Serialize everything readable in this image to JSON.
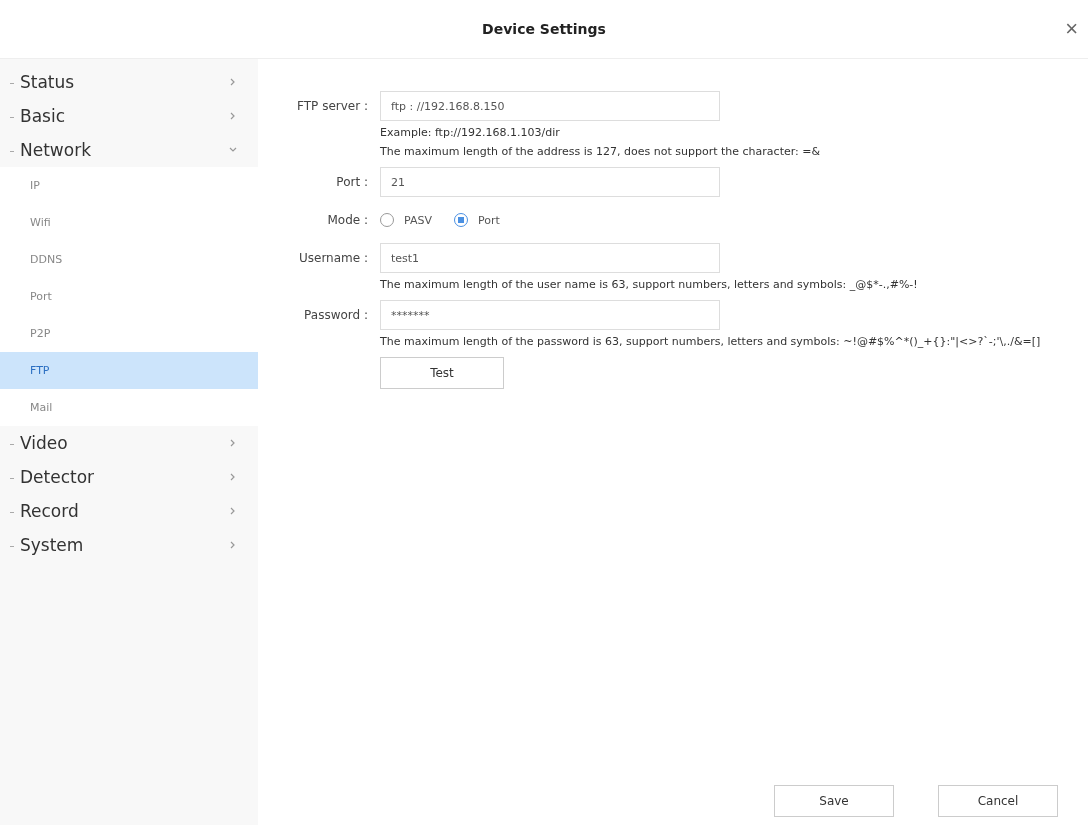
{
  "window": {
    "title": "Device Settings",
    "close": "×"
  },
  "sidebar": {
    "items": [
      {
        "label": "Status",
        "expanded": false,
        "selected": false
      },
      {
        "label": "Basic",
        "expanded": false,
        "selected": false
      },
      {
        "label": "Network",
        "expanded": true,
        "selected": false,
        "children": [
          {
            "label": "IP",
            "selected": false
          },
          {
            "label": "Wifi",
            "selected": false
          },
          {
            "label": "DDNS",
            "selected": false
          },
          {
            "label": "Port",
            "selected": false
          },
          {
            "label": "P2P",
            "selected": false
          },
          {
            "label": "FTP",
            "selected": true
          },
          {
            "label": "Mail",
            "selected": false
          }
        ]
      },
      {
        "label": "Video",
        "expanded": false,
        "selected": false
      },
      {
        "label": "Detector",
        "expanded": false,
        "selected": false
      },
      {
        "label": "Record",
        "expanded": false,
        "selected": false
      },
      {
        "label": "System",
        "expanded": false,
        "selected": false
      }
    ]
  },
  "form": {
    "rows": [
      {
        "kind": "text",
        "label": "FTP server :",
        "value": "ftp : //192.168.8.150",
        "hints": [
          "Example: ftp://192.168.1.103/dir",
          "The maximum length of the address is 127, does not support the character: =&"
        ]
      },
      {
        "kind": "text",
        "label": "Port :",
        "value": "21"
      },
      {
        "kind": "radio",
        "label": "Mode :",
        "options": [
          {
            "label": "PASV",
            "selected": false
          },
          {
            "label": "Port",
            "selected": true
          }
        ]
      },
      {
        "kind": "text",
        "label": "Username :",
        "value": "test1",
        "hints": [
          "The maximum length of the user name is 63, support numbers, letters and symbols: _@$*-.,#%-!"
        ]
      },
      {
        "kind": "text",
        "label": "Password :",
        "value": "*******",
        "hints": [
          "The maximum length of the password is 63, support numbers, letters and symbols: ~!@#$%^*()_+{}:\"|<>?`-;'\\,./&=[]"
        ]
      }
    ],
    "test_button": "Test"
  },
  "footer": {
    "buttons": [
      "Save",
      "Cancel"
    ]
  }
}
